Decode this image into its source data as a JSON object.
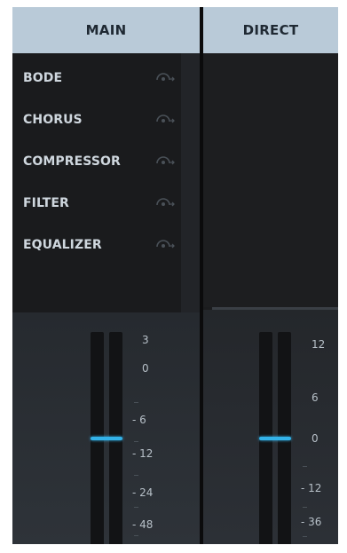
{
  "main": {
    "header": "MAIN",
    "effects": [
      {
        "label": "BODE",
        "icon": "send-knob-icon"
      },
      {
        "label": "CHORUS",
        "icon": "send-knob-icon"
      },
      {
        "label": "COMPRESSOR",
        "icon": "send-knob-icon"
      },
      {
        "label": "FILTER",
        "icon": "send-knob-icon"
      },
      {
        "label": "EQUALIZER",
        "icon": "send-knob-icon"
      }
    ],
    "fader": {
      "scale": [
        "3",
        "0",
        "- 6",
        "- 12",
        "- 24",
        "- 48"
      ],
      "level_db": -9
    }
  },
  "direct": {
    "header": "DIRECT",
    "fader": {
      "scale": [
        "12",
        "6",
        "0",
        "- 12",
        "- 36"
      ],
      "level_db": 0
    }
  },
  "colors": {
    "header_bg": "#b9cad8",
    "panel_bg": "#1b1c1e",
    "fader_thumb": "#33b2e8",
    "label_text": "#cfd7de"
  }
}
